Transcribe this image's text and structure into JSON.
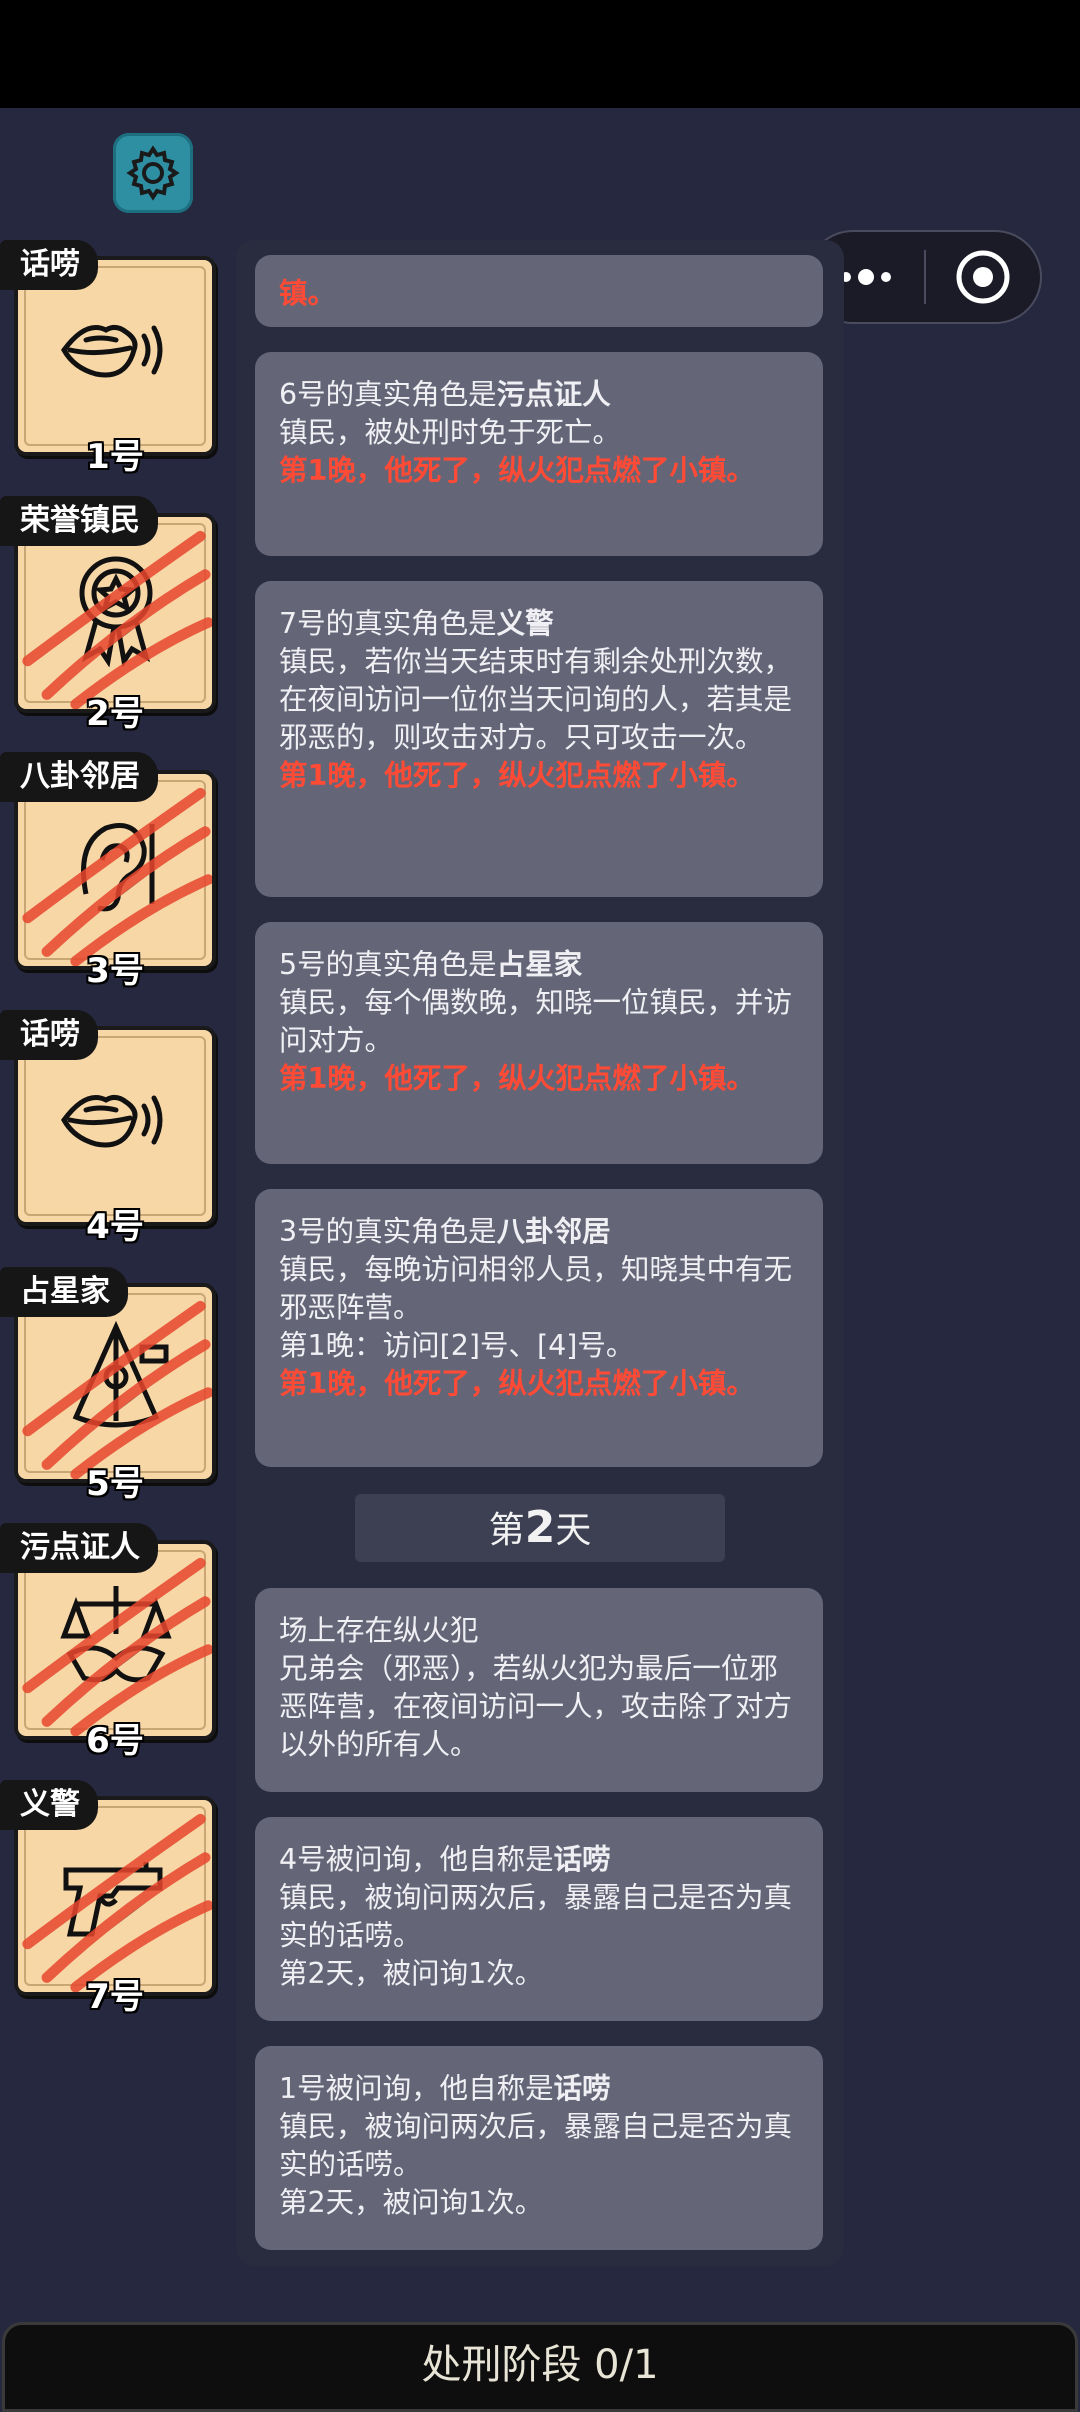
{
  "header": {
    "settings_icon": "gear-icon",
    "menu_icon": "more-dots-icon",
    "close_icon": "target-circle-icon"
  },
  "players": [
    {
      "tag": "话唠",
      "num": "1号",
      "icon": "mouth-speaking-icon",
      "dead": false
    },
    {
      "tag": "荣誉镇民",
      "num": "2号",
      "icon": "medal-icon",
      "dead": true
    },
    {
      "tag": "八卦邻居",
      "num": "3号",
      "icon": "ear-icon",
      "dead": true
    },
    {
      "tag": "话唠",
      "num": "4号",
      "icon": "mouth-speaking-icon",
      "dead": false
    },
    {
      "tag": "占星家",
      "num": "5号",
      "icon": "sextant-icon",
      "dead": true
    },
    {
      "tag": "污点证人",
      "num": "6号",
      "icon": "scales-handshake-icon",
      "dead": true
    },
    {
      "tag": "义警",
      "num": "7号",
      "icon": "pistol-icon",
      "dead": true
    }
  ],
  "log": {
    "partial": "镇。",
    "m6": {
      "pre": "6号的真实角色是",
      "role": "污点证人",
      "desc": "镇民，被处刑时免于死亡。",
      "death": "第1晚，他死了，纵火犯点燃了小镇。"
    },
    "m7": {
      "pre": "7号的真实角色是",
      "role": "义警",
      "desc": "镇民，若你当天结束时有剩余处刑次数，在夜间访问一位你当天问询的人，若其是邪恶的，则攻击对方。只可攻击一次。",
      "death": "第1晚，他死了，纵火犯点燃了小镇。"
    },
    "m5": {
      "pre": "5号的真实角色是",
      "role": "占星家",
      "desc": "镇民，每个偶数晚，知晓一位镇民，并访问对方。",
      "death": "第1晚，他死了，纵火犯点燃了小镇。"
    },
    "m3": {
      "pre": "3号的真实角色是",
      "role": "八卦邻居",
      "desc": "镇民，每晚访问相邻人员，知晓其中有无邪恶阵营。",
      "extra": "第1晚：访问[2]号、[4]号。",
      "death": "第1晚，他死了，纵火犯点燃了小镇。"
    },
    "day": {
      "pre": "第",
      "num": "2",
      "post": "天"
    },
    "arson": {
      "title": "场上存在纵火犯",
      "desc": "兄弟会（邪恶），若纵火犯为最后一位邪恶阵营，在夜间访问一人，攻击除了对方以外的所有人。"
    },
    "q4": {
      "pre": "4号被问询，他自称是",
      "role": "话唠",
      "desc": "镇民，被询问两次后，暴露自己是否为真实的话唠。",
      "count": "第2天，被问询1次。"
    },
    "q1": {
      "pre": "1号被问询，他自称是",
      "role": "话唠",
      "desc": "镇民，被询问两次后，暴露自己是否为真实的话唠。",
      "count": "第2天，被问询1次。"
    }
  },
  "footer": {
    "phase": "处刑阶段 0/1"
  }
}
